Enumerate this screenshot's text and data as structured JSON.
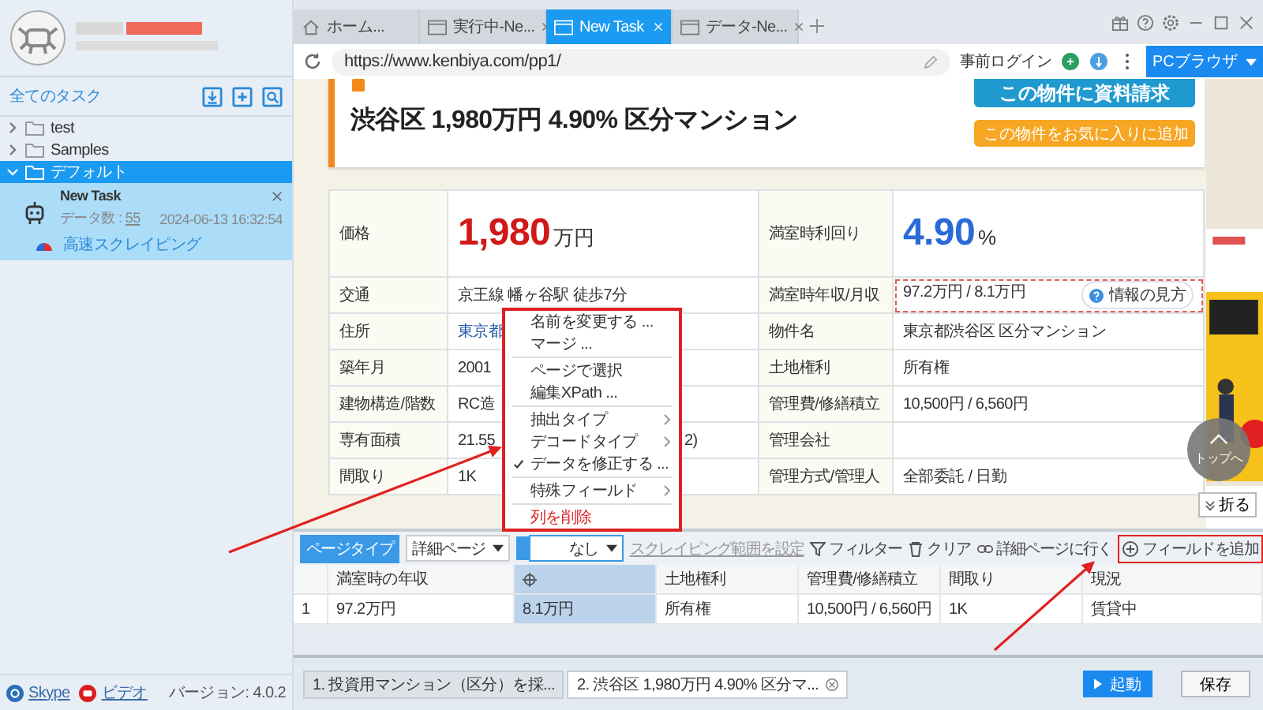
{
  "sidebar": {
    "all_tasks": "全てのタスク",
    "folders": [
      {
        "label": "test",
        "expanded": false,
        "selected": false
      },
      {
        "label": "Samples",
        "expanded": false,
        "selected": false
      },
      {
        "label": "デフォルト",
        "expanded": true,
        "selected": true,
        "tasks": [
          {
            "name": "New Task",
            "count_label": "データ数 :",
            "count": "55",
            "time": "2024-06-13 16:32:54",
            "mode": "高速スクレイピング"
          }
        ]
      }
    ],
    "links": [
      {
        "label": "Skype",
        "kind": "skype"
      },
      {
        "label": "ビデオ",
        "kind": "video"
      }
    ],
    "version": "バージョン: 4.0.2"
  },
  "browser_tabs": [
    {
      "label": "ホーム...",
      "kind": "home",
      "selected": false
    },
    {
      "label": "実行中-Ne...",
      "kind": "page",
      "selected": false
    },
    {
      "label": "New Task",
      "kind": "page",
      "selected": true
    },
    {
      "label": "データ-Ne...",
      "kind": "page",
      "selected": false
    }
  ],
  "address_bar": {
    "url": "https://www.kenbiya.com/pp1/",
    "pre_login": "事前ログイン",
    "mode_button": "PCブラウザ"
  },
  "web_page": {
    "title": "渋谷区 1,980万円 4.90% 区分マンション",
    "request_button": "この物件に資料請求",
    "favorite_button": "この物件をお気に入りに追加",
    "price": {
      "label": "価格",
      "value": "1,980",
      "unit": "万円",
      "yield_label": "満室時利回り",
      "yield_value": "4.90",
      "yield_unit": "%"
    },
    "rows": [
      {
        "label": "交通",
        "value": "京王線 幡ヶ谷駅 徒歩7分",
        "link": false,
        "label_2": "満室時年収/月収",
        "value_2": "97.2万円 / 8.1万円",
        "highlighted": true,
        "badge": "情報の見方"
      },
      {
        "label": "住所",
        "value": "東京都",
        "link": true,
        "label_2": "物件名",
        "value_2": "東京都渋谷区 区分マンション",
        "highlighted": false
      },
      {
        "label": "築年月",
        "value": "2001",
        "link": false,
        "label_2": "土地権利",
        "value_2": "所有権",
        "highlighted": false
      },
      {
        "label": "建物構造/階数",
        "value": "RC造",
        "link": false,
        "label_2": "管理費/修繕積立",
        "value_2": "10,500円 / 6,560円",
        "highlighted": false
      },
      {
        "label": "専有面積",
        "value": "21.55",
        "value_tail": "2)",
        "link": false,
        "label_2": "管理会社",
        "highlighted": false
      },
      {
        "label": "間取り",
        "value": "1K",
        "link": false,
        "label_2": "管理方式/管理人",
        "value_2": "全部委託 / 日勤",
        "highlighted": false
      }
    ],
    "to_top": "トップへ",
    "collapse": "折る"
  },
  "toolbar": {
    "page_type_label": "ページタイプ",
    "page_type_value": "詳細ページ",
    "second_value": "なし",
    "range_link": "スクレイピング範囲を設定",
    "filter": "フィルター",
    "clear": "クリア",
    "goto_detail": "詳細ページに行く",
    "add_field": "フィールドを追加"
  },
  "data_table": {
    "columns": [
      {
        "label": "満室時の年収",
        "selected": false
      },
      {
        "selected": true
      },
      {
        "label": "土地権利",
        "selected": false
      },
      {
        "label": "管理費/修繕積立",
        "selected": false
      },
      {
        "label": "間取り",
        "selected": false
      },
      {
        "label": "現況",
        "selected": false
      }
    ],
    "rows": [
      {
        "index": "1",
        "cells": [
          "97.2万円",
          "8.1万円",
          "所有権",
          "10,500円 / 6,560円",
          "1K",
          "賃貸中"
        ]
      }
    ]
  },
  "context_menu": {
    "items": [
      {
        "kind": "item",
        "label": "名前を変更する ...",
        "checked": false
      },
      {
        "kind": "item",
        "label": "マージ ...",
        "checked": false
      },
      {
        "kind": "separator"
      },
      {
        "kind": "item",
        "label": "ページで選択",
        "checked": false
      },
      {
        "kind": "item",
        "label": "編集XPath ...",
        "checked": false
      },
      {
        "kind": "separator"
      },
      {
        "kind": "submenu",
        "label": "抽出タイプ",
        "checked": false
      },
      {
        "kind": "submenu",
        "label": "デコードタイプ",
        "checked": false
      },
      {
        "kind": "item",
        "label": "データを修正する ...",
        "checked": true
      },
      {
        "kind": "separator"
      },
      {
        "kind": "submenu",
        "label": "特殊フィールド",
        "checked": false
      },
      {
        "kind": "separator"
      },
      {
        "kind": "danger",
        "label": "列を削除",
        "checked": false
      }
    ]
  },
  "steps": [
    {
      "label": "1. 投資用マンション（区分）を採...",
      "selected": false
    },
    {
      "label": "2. 渋谷区 1,980万円 4.90% 区分マ...",
      "selected": true
    }
  ],
  "actions": {
    "start": "起動",
    "save": "保存"
  }
}
